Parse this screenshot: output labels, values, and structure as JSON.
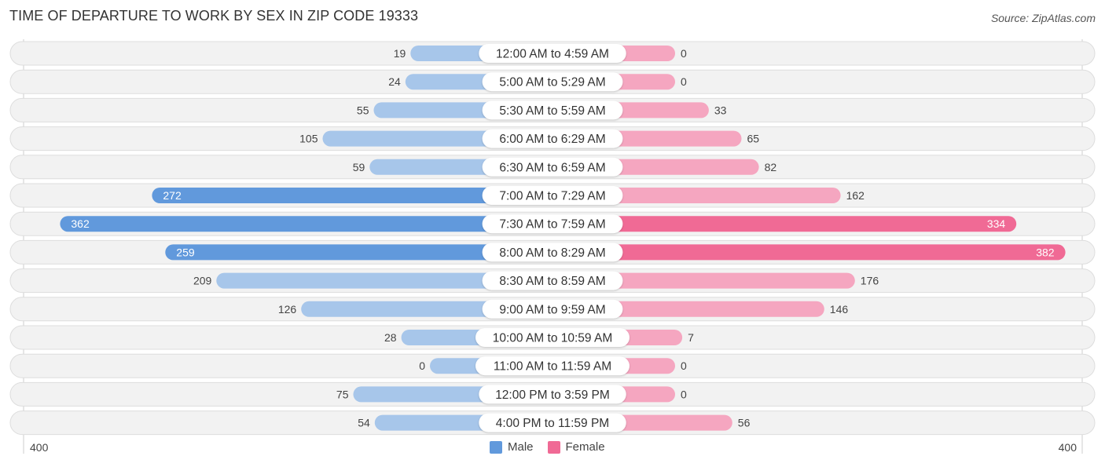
{
  "title": "TIME OF DEPARTURE TO WORK BY SEX IN ZIP CODE 19333",
  "source": "Source: ZipAtlas.com",
  "colors": {
    "male_strong": "#6199dc",
    "male_light": "#a7c6ea",
    "female_strong": "#f06a95",
    "female_light": "#f5a6c0",
    "row_bg": "#f2f2f2",
    "row_border": "#dddddd"
  },
  "axis": {
    "left_label": "400",
    "right_label": "400"
  },
  "legend": [
    {
      "label": "Male",
      "color": "#6199dc"
    },
    {
      "label": "Female",
      "color": "#f06a95"
    }
  ],
  "chart_data": {
    "type": "bar",
    "orientation": "horizontal-butterfly",
    "title": "TIME OF DEPARTURE TO WORK BY SEX IN ZIP CODE 19333",
    "xlim": [
      0,
      400
    ],
    "categories": [
      "12:00 AM to 4:59 AM",
      "5:00 AM to 5:29 AM",
      "5:30 AM to 5:59 AM",
      "6:00 AM to 6:29 AM",
      "6:30 AM to 6:59 AM",
      "7:00 AM to 7:29 AM",
      "7:30 AM to 7:59 AM",
      "8:00 AM to 8:29 AM",
      "8:30 AM to 8:59 AM",
      "9:00 AM to 9:59 AM",
      "10:00 AM to 10:59 AM",
      "11:00 AM to 11:59 AM",
      "12:00 PM to 3:59 PM",
      "4:00 PM to 11:59 PM"
    ],
    "series": [
      {
        "name": "Male",
        "values": [
          19,
          24,
          55,
          105,
          59,
          272,
          362,
          259,
          209,
          126,
          28,
          0,
          75,
          54
        ]
      },
      {
        "name": "Female",
        "values": [
          0,
          0,
          33,
          65,
          82,
          162,
          334,
          382,
          176,
          146,
          7,
          0,
          0,
          56
        ]
      }
    ],
    "legend_position": "bottom-center"
  }
}
